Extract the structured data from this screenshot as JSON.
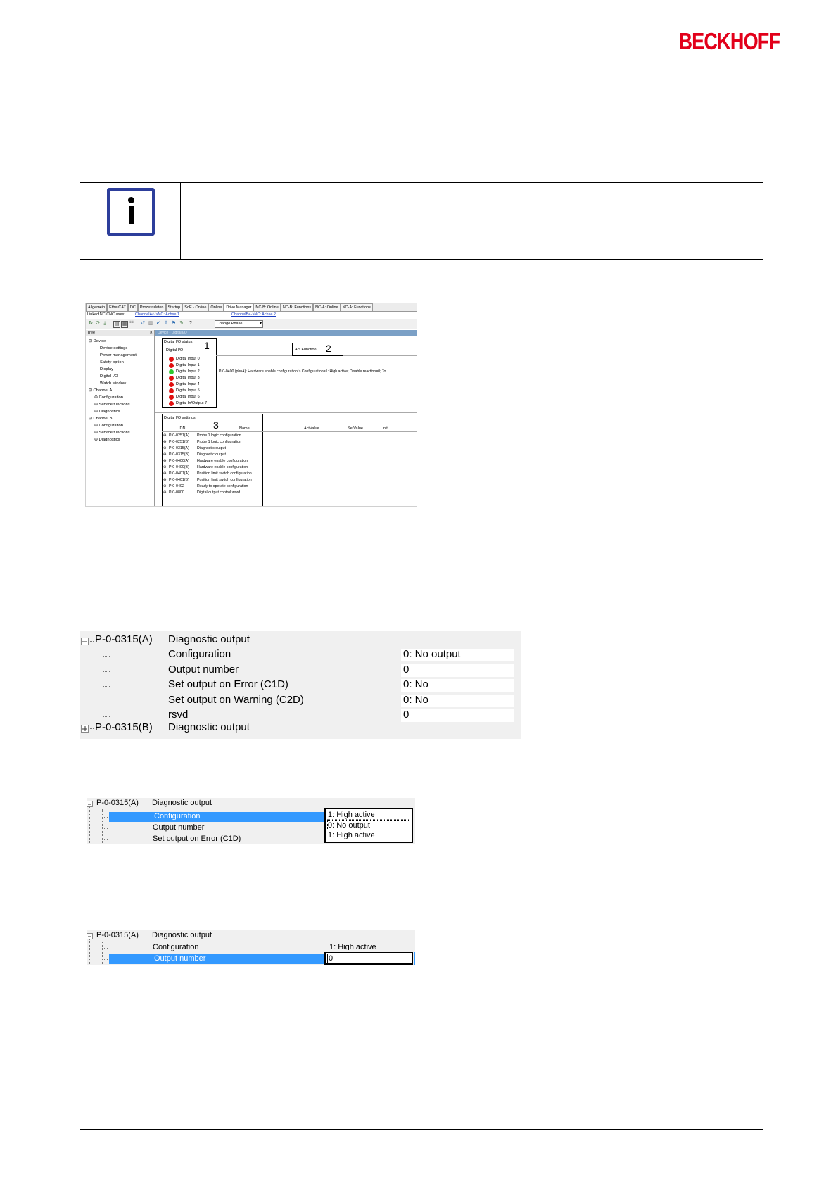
{
  "header": {
    "logo_text": "BECKHOFF",
    "logo_color": "#e2001a"
  },
  "note": {
    "icon": "info-icon",
    "icon_color": "#2d3e9b"
  },
  "shot1": {
    "tabs": [
      "Allgemein",
      "EtherCAT",
      "DC",
      "Prozessdaten",
      "Startup",
      "SoE - Online",
      "Online",
      "Drive Manager",
      "NC-B: Online",
      "NC-B: Functions",
      "NC-A: Online",
      "NC-A: Functions"
    ],
    "active_tab": "Drive Manager",
    "linked_label": "Linked NC/CNC axes:",
    "link_a": "ChannelA<->NC: Achse 1",
    "link_b": "ChannelB<->NC: Achse 2",
    "phase_select": "Change Phase",
    "tree_header": "Tree",
    "tree": [
      {
        "label": "Device",
        "indent": 0
      },
      {
        "label": "Device settings",
        "indent": 2
      },
      {
        "label": "Power management",
        "indent": 2
      },
      {
        "label": "Safety option",
        "indent": 2
      },
      {
        "label": "Display",
        "indent": 2
      },
      {
        "label": "Digital I/O",
        "indent": 2
      },
      {
        "label": "Watch window",
        "indent": 2
      },
      {
        "label": "Channel A",
        "indent": 0
      },
      {
        "label": "Configuration",
        "indent": 1
      },
      {
        "label": "Service functions",
        "indent": 1
      },
      {
        "label": "Diagnostics",
        "indent": 1
      },
      {
        "label": "Channel B",
        "indent": 0
      },
      {
        "label": "Configuration",
        "indent": 1
      },
      {
        "label": "Service functions",
        "indent": 1
      },
      {
        "label": "Diagnostics",
        "indent": 1
      }
    ],
    "breadcrumb": "Device - Digital I/O",
    "io_status_title": "Digital I/O status:",
    "io_group": "Digital I/O",
    "callouts": [
      "1",
      "2",
      "3"
    ],
    "act_function": "Act Function",
    "act_function_text": "P-0-0400 (phnA): Hardware enable configuration > Configuration=1: High active; Disable reaction=0; To...",
    "io_list": [
      {
        "label": "Digital Input 0",
        "color": "#e01010"
      },
      {
        "label": "Digital Input 1",
        "color": "#e01010"
      },
      {
        "label": "Digital Input 2",
        "color": "#2ec82e"
      },
      {
        "label": "Digital Input 3",
        "color": "#e01010"
      },
      {
        "label": "Digital Input 4",
        "color": "#e01010"
      },
      {
        "label": "Digital Input 5",
        "color": "#e01010"
      },
      {
        "label": "Digital Input 6",
        "color": "#e01010"
      },
      {
        "label": "Digital In/Output 7",
        "color": "#e01010"
      }
    ],
    "io_settings_title": "Digital I/O settings:",
    "columns": [
      "IDN",
      "Name",
      "ActValue",
      "SetValue",
      "Unit"
    ],
    "settings": [
      {
        "idn": "P-0-0251(A)",
        "name": "Probe 1 logic configuration"
      },
      {
        "idn": "P-0-0251(B)",
        "name": "Probe 1 logic configuration"
      },
      {
        "idn": "P-0-0315(A)",
        "name": "Diagnostic output"
      },
      {
        "idn": "P-0-0315(B)",
        "name": "Diagnostic output"
      },
      {
        "idn": "P-0-0400(A)",
        "name": "Hardware enable configuration"
      },
      {
        "idn": "P-0-0400(B)",
        "name": "Hardware enable configuration"
      },
      {
        "idn": "P-0-0401(A)",
        "name": "Position limit switch configuration"
      },
      {
        "idn": "P-0-0401(B)",
        "name": "Position limit switch configuration"
      },
      {
        "idn": "P-0-0402",
        "name": "Ready to operate configuration"
      },
      {
        "idn": "P-0-0800",
        "name": "Digital output control word"
      }
    ]
  },
  "table2": {
    "header_idn": "P-0-0315(A)",
    "header_name": "Diagnostic output",
    "rows": [
      {
        "name": "Configuration",
        "value": "0: No output"
      },
      {
        "name": "Output number",
        "value": "0"
      },
      {
        "name": "Set output on Error (C1D)",
        "value": "0: No"
      },
      {
        "name": "Set output on Warning (C2D)",
        "value": "0: No"
      },
      {
        "name": "rsvd",
        "value": "0"
      }
    ],
    "footer_idn": "P-0-0315(B)",
    "footer_name": "Diagnostic output"
  },
  "table3": {
    "header_idn": "P-0-0315(A)",
    "header_name": "Diagnostic output",
    "rows": [
      "Configuration",
      "Output number",
      "Set output on Error (C1D)"
    ],
    "selected": "Configuration",
    "dropdown_value": "1: High active",
    "dropdown_options": [
      "0: No output",
      "1: High active"
    ]
  },
  "table4": {
    "header_idn": "P-0-0315(A)",
    "header_name": "Diagnostic output",
    "rows": [
      "Configuration",
      "Output number"
    ],
    "config_value": "1: High active",
    "selected": "Output number",
    "edit_value": "0"
  }
}
